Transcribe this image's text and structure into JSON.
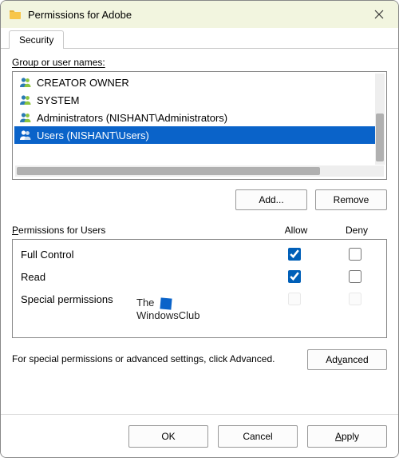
{
  "title": "Permissions for Adobe",
  "tab": {
    "security": "Security"
  },
  "groupLabel": "Group or user names:",
  "groups": [
    {
      "label": "CREATOR OWNER",
      "selected": false
    },
    {
      "label": "SYSTEM",
      "selected": false
    },
    {
      "label": "Administrators (NISHANT\\Administrators)",
      "selected": false
    },
    {
      "label": "Users (NISHANT\\Users)",
      "selected": true
    }
  ],
  "buttons": {
    "add": "Add...",
    "remove": "Remove",
    "advanced": "Advanced",
    "ok": "OK",
    "cancel": "Cancel",
    "apply": "Apply"
  },
  "permHeader": {
    "label": "Permissions for Users",
    "allow": "Allow",
    "deny": "Deny"
  },
  "perms": [
    {
      "name": "Full Control",
      "allow": true,
      "deny": false,
      "enabled": true
    },
    {
      "name": "Read",
      "allow": true,
      "deny": false,
      "enabled": true
    },
    {
      "name": "Special permissions",
      "allow": false,
      "deny": false,
      "enabled": false
    }
  ],
  "advancedText": "For special permissions or advanced settings, click Advanced.",
  "watermark": {
    "line1": "The",
    "line2": "WindowsClub"
  }
}
